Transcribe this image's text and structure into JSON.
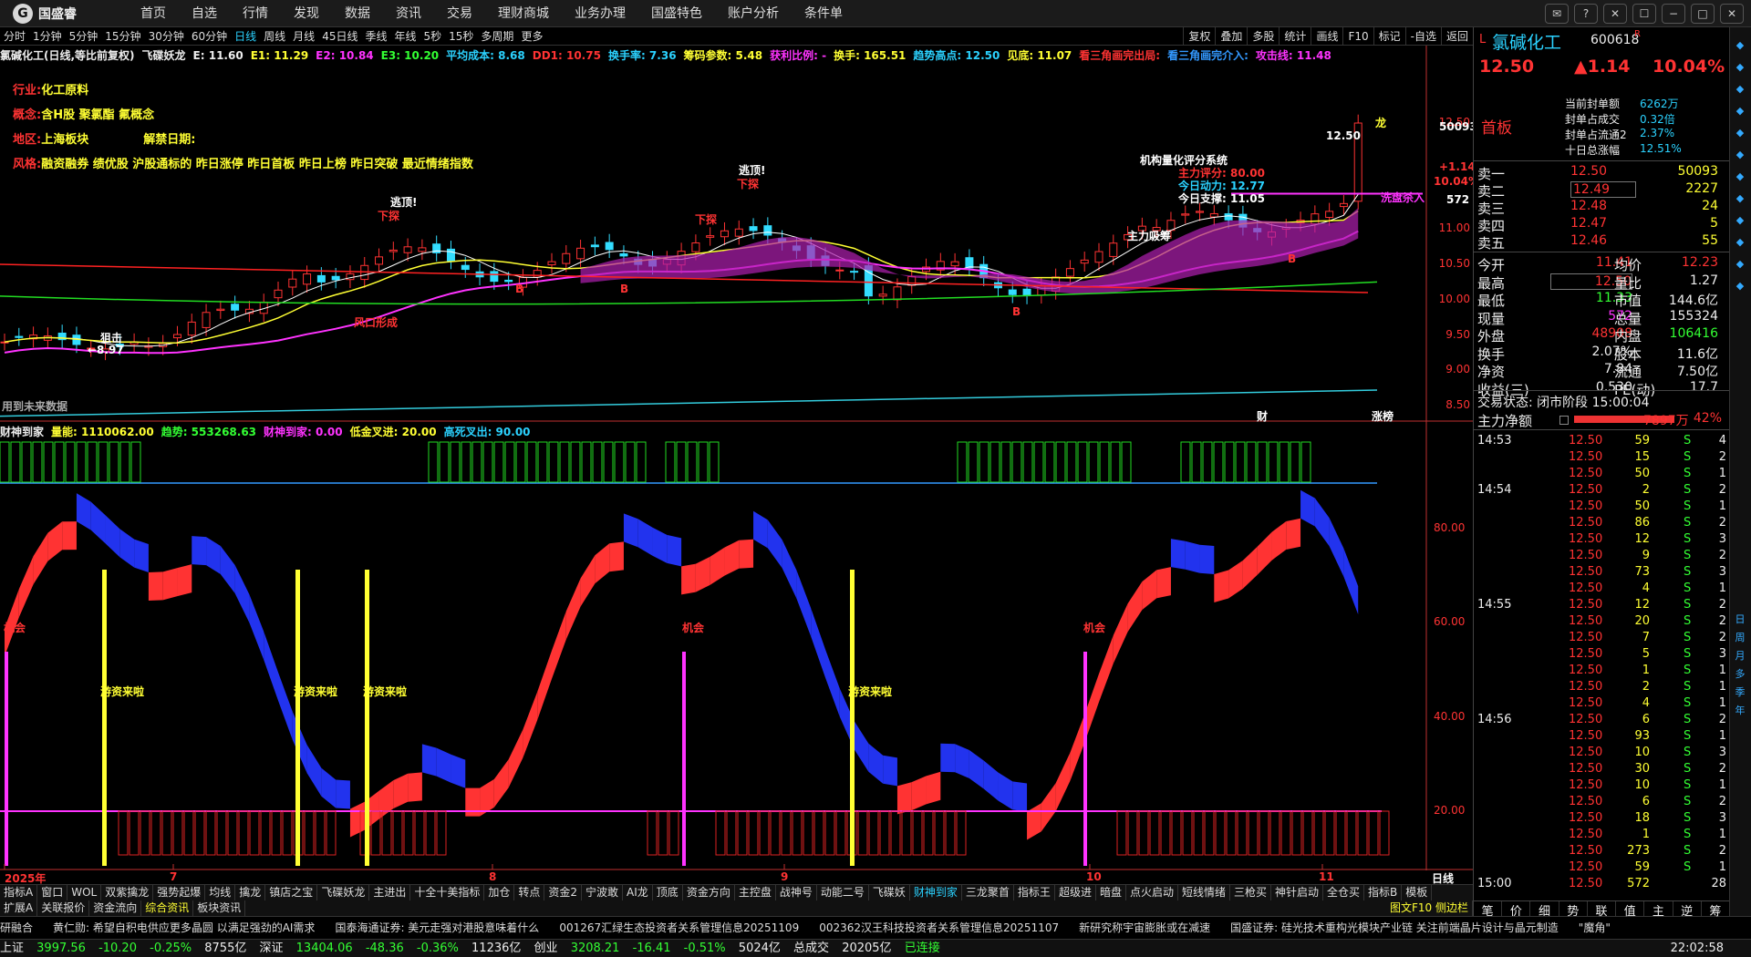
{
  "topbar": {
    "logo_text": "国盛睿",
    "menu": [
      "首页",
      "自选",
      "行情",
      "发现",
      "数据",
      "资讯",
      "交易",
      "理财商城",
      "业务办理",
      "国盛特色",
      "账户分析",
      "条件单"
    ]
  },
  "period_bar": {
    "periods": [
      "分时",
      "1分钟",
      "5分钟",
      "15分钟",
      "30分钟",
      "60分钟",
      "日线",
      "周线",
      "月线",
      "45日线",
      "季线",
      "年线",
      "5秒",
      "15秒",
      "多周期",
      "更多"
    ],
    "active": "日线",
    "buttons": [
      "复权",
      "叠加",
      "多股",
      "统计",
      "画线",
      "F10",
      "标记",
      "-自选",
      "返回"
    ]
  },
  "indicator_line": [
    {
      "t": "氯碱化工(日线,等比前复权)",
      "c": "#eeeeee"
    },
    {
      "t": "飞碟妖龙",
      "c": "#eeeeee"
    },
    {
      "t": "E: 11.60",
      "c": "#eeeeee"
    },
    {
      "t": "E1: 11.29",
      "c": "#ffff33"
    },
    {
      "t": "E2: 10.84",
      "c": "#ff33ff"
    },
    {
      "t": "E3: 10.20",
      "c": "#33ff33"
    },
    {
      "t": "平均成本: 8.68",
      "c": "#2bd2ff"
    },
    {
      "t": "DD1: 10.75",
      "c": "#ff3333"
    },
    {
      "t": "换手率: 7.36",
      "c": "#2bd2ff"
    },
    {
      "t": "筹码参数: 5.48",
      "c": "#ffff33"
    },
    {
      "t": "获利比例: -",
      "c": "#ff33ff"
    },
    {
      "t": "换手: 165.51",
      "c": "#ffff33"
    },
    {
      "t": "趋势高点: 12.50",
      "c": "#2bd2ff"
    },
    {
      "t": "见底: 11.07",
      "c": "#ffff33"
    },
    {
      "t": "看三角画完出局:",
      "c": "#ff3333"
    },
    {
      "t": "看三角画完介入:",
      "c": "#3399ff"
    },
    {
      "t": "攻击线: 11.48",
      "c": "#ff33ff"
    }
  ],
  "info": [
    {
      "k": "行业:",
      "v": "化工原料"
    },
    {
      "k": "概念:",
      "v": "含H股 聚氯酯 氟概念"
    },
    {
      "k": "地区:",
      "v": "上海板块",
      "k2": "解禁日期:",
      "v2": ""
    },
    {
      "k": "风格:",
      "v": "融资融券 绩优股 沪股通标的 昨日涨停 昨日首板 昨日上榜 昨日突破 最近情绪指数"
    }
  ],
  "upper_axis": [
    "12.50",
    "11.00",
    "10.50",
    "10.00",
    "9.50",
    "9.00",
    "8.50"
  ],
  "right_top_labels": {
    "price": "12.50",
    "vol": "50093",
    "pct": "+1.14",
    "pct2": "10.04%",
    "vol2": "572"
  },
  "chart_annotations": {
    "escape": [
      "逃顶!",
      "逃顶!"
    ],
    "down": [
      "下探",
      "下探"
    ],
    "rise": "龙",
    "xi_pan": "洗盘杀入",
    "jigou": "机构量化评分系统",
    "jigou_items": [
      "主力评分: 80.00",
      "今日动力: 12.77",
      "今日支撑: 11.05"
    ],
    "zhuli": "主力吸筹",
    "ju_chu": "狙击",
    "price_low": "←8.97",
    "feng_kou": "风口形成",
    "no_data": "用到未来数据",
    "cai": "财",
    "zhang": "涨榜",
    "b": "B"
  },
  "lower_indicator": [
    {
      "t": "财神到家",
      "c": "#eeeeee"
    },
    {
      "t": "量能: 1110062.00",
      "c": "#ffff33"
    },
    {
      "t": "趋势: 553268.63",
      "c": "#33ff33"
    },
    {
      "t": "财神到家: 0.00",
      "c": "#ff33ff"
    },
    {
      "t": "低金叉进: 20.00",
      "c": "#ffff33"
    },
    {
      "t": "高死叉出: 90.00",
      "c": "#2bd2ff"
    }
  ],
  "lower_axis": [
    "80.00",
    "60.00",
    "40.00",
    "20.00"
  ],
  "lower_labels": {
    "chance": "机会",
    "youzi": "游资来啦"
  },
  "x_labels": [
    "2025年",
    "7",
    "8",
    "9",
    "10",
    "11"
  ],
  "x_right": "日线",
  "tabs1": [
    "指标A",
    "窗口",
    "WOL",
    "双紫擒龙",
    "强势起爆",
    "均线",
    "擒龙",
    "镇店之宝",
    "飞碟妖龙",
    "主进出",
    "十全十美指标",
    "加仓",
    "转点",
    "资金2",
    "宁波敢",
    "AI龙",
    "顶底",
    "资金方向",
    "主控盘",
    "战神号",
    "动能二号",
    "飞碟妖",
    "财神到家",
    "三龙聚首",
    "指标王",
    "超级进",
    "暗盘",
    "点火启动",
    "短线情绪",
    "三枪买",
    "神针启动",
    "全仓买",
    "指标B",
    "模板"
  ],
  "tabs1_active": "财神到家",
  "tabs2": [
    "扩展A",
    "关联报价",
    "资金流向",
    "综合资讯",
    "板块资讯"
  ],
  "tabs2_right": "图文F10 侧边栏",
  "news": [
    "研融合",
    "黄仁勋: 希望自积电供应更多晶圆 以满足强劲的AI需求",
    "国泰海通证券: 美元走强对港股意味着什么",
    "001267汇绿生态投资者关系管理信息20251109",
    "002362汉王科技投资者关系管理信息20251107",
    "新研究称宇宙膨胀或在减速",
    "国盛证券: 硅光技术重构光模块产业链 关注前端晶片设计与晶元制造",
    "\"魔角\""
  ],
  "statusbar": {
    "sh_label": "上证",
    "sh": "3997.56",
    "sh_chg": "-10.20",
    "sh_pct": "-0.25%",
    "sh_amt": "8755亿",
    "sz_label": "深证",
    "sz": "13404.06",
    "sz_chg": "-48.36",
    "sz_pct": "-0.36%",
    "sz_amt": "11236亿",
    "cy_label": "创业",
    "cy": "3208.21",
    "cy_chg": "-16.41",
    "cy_pct": "-0.51%",
    "cy_amt": "5024亿",
    "total_label": "总成交",
    "total": "20205亿",
    "conn": "已连接",
    "time": "22:02:58"
  },
  "stock": {
    "prefix": "L",
    "name": "氯碱化工",
    "code": "600618",
    "r": "R",
    "price": "12.50",
    "change": "▲1.14",
    "pct": "10.04%",
    "board": "首板",
    "seal": [
      [
        "当前封单额",
        "6262万"
      ],
      [
        "封单占成交",
        "0.32倍"
      ],
      [
        "封单占流通2",
        "2.37%"
      ],
      [
        "十日总涨幅",
        "12.51%"
      ]
    ],
    "orders": [
      [
        "卖一",
        "12.50",
        "50093"
      ],
      [
        "卖二",
        "12.49",
        "2227"
      ],
      [
        "卖三",
        "12.48",
        "24"
      ],
      [
        "卖四",
        "12.47",
        "5"
      ],
      [
        "卖五",
        "12.46",
        "55"
      ]
    ],
    "stats": [
      [
        "今开",
        "11.41",
        "均价",
        "12.23"
      ],
      [
        "最高",
        "12.50",
        "量比",
        "1.27"
      ],
      [
        "最低",
        "11.33",
        "市值",
        "144.6亿"
      ],
      [
        "现量",
        "572",
        "总量",
        "155324"
      ],
      [
        "外盘",
        "48908",
        "内盘",
        "106416"
      ],
      [
        "换手",
        "2.07%",
        "股本",
        "11.6亿"
      ],
      [
        "净资",
        "7.84",
        "流通",
        "7.50亿"
      ],
      [
        "收益(三)",
        "0.530",
        "PE(动)",
        "17.7"
      ]
    ],
    "trade_state": "交易状态: 闭市阶段 15:00:04",
    "main_flow_label": "主力净额",
    "main_flow": "7897万",
    "main_flow_pct": "42%"
  },
  "ticks": [
    {
      "t": "14:53",
      "p": "12.50",
      "v": "59",
      "s": "S",
      "n": "4"
    },
    {
      "t": "",
      "p": "12.50",
      "v": "15",
      "s": "S",
      "n": "2"
    },
    {
      "t": "",
      "p": "12.50",
      "v": "50",
      "s": "S",
      "n": "1"
    },
    {
      "t": "14:54",
      "p": "12.50",
      "v": "2",
      "s": "S",
      "n": "2"
    },
    {
      "t": "",
      "p": "12.50",
      "v": "50",
      "s": "S",
      "n": "1"
    },
    {
      "t": "",
      "p": "12.50",
      "v": "86",
      "s": "S",
      "n": "2"
    },
    {
      "t": "",
      "p": "12.50",
      "v": "12",
      "s": "S",
      "n": "3"
    },
    {
      "t": "",
      "p": "12.50",
      "v": "9",
      "s": "S",
      "n": "2"
    },
    {
      "t": "",
      "p": "12.50",
      "v": "73",
      "s": "S",
      "n": "3"
    },
    {
      "t": "",
      "p": "12.50",
      "v": "4",
      "s": "S",
      "n": "1"
    },
    {
      "t": "14:55",
      "p": "12.50",
      "v": "12",
      "s": "S",
      "n": "2"
    },
    {
      "t": "",
      "p": "12.50",
      "v": "20",
      "s": "S",
      "n": "2"
    },
    {
      "t": "",
      "p": "12.50",
      "v": "7",
      "s": "S",
      "n": "2"
    },
    {
      "t": "",
      "p": "12.50",
      "v": "5",
      "s": "S",
      "n": "3"
    },
    {
      "t": "",
      "p": "12.50",
      "v": "1",
      "s": "S",
      "n": "1"
    },
    {
      "t": "",
      "p": "12.50",
      "v": "2",
      "s": "S",
      "n": "1"
    },
    {
      "t": "",
      "p": "12.50",
      "v": "4",
      "s": "S",
      "n": "1"
    },
    {
      "t": "14:56",
      "p": "12.50",
      "v": "6",
      "s": "S",
      "n": "2"
    },
    {
      "t": "",
      "p": "12.50",
      "v": "93",
      "s": "S",
      "n": "1"
    },
    {
      "t": "",
      "p": "12.50",
      "v": "10",
      "s": "S",
      "n": "3"
    },
    {
      "t": "",
      "p": "12.50",
      "v": "30",
      "s": "S",
      "n": "2"
    },
    {
      "t": "",
      "p": "12.50",
      "v": "10",
      "s": "S",
      "n": "1"
    },
    {
      "t": "",
      "p": "12.50",
      "v": "6",
      "s": "S",
      "n": "2"
    },
    {
      "t": "",
      "p": "12.50",
      "v": "18",
      "s": "S",
      "n": "3"
    },
    {
      "t": "",
      "p": "12.50",
      "v": "1",
      "s": "S",
      "n": "1"
    },
    {
      "t": "",
      "p": "12.50",
      "v": "273",
      "s": "S",
      "n": "2"
    },
    {
      "t": "",
      "p": "12.50",
      "v": "59",
      "s": "S",
      "n": "1"
    },
    {
      "t": "15:00",
      "p": "12.50",
      "v": "572",
      "s": "",
      "n": "28"
    }
  ],
  "rbottom_tabs": [
    "笔",
    "价",
    "细",
    "势",
    "联",
    "值",
    "主",
    "逆",
    "筹"
  ],
  "side_strip": [
    "日",
    "周",
    "月",
    "多",
    "季",
    "年"
  ],
  "colors": {
    "up": "#ff3333",
    "down": "#33ff33",
    "accent": "#2bd2ff",
    "yellow": "#ffff33",
    "magenta": "#ff33ff"
  }
}
